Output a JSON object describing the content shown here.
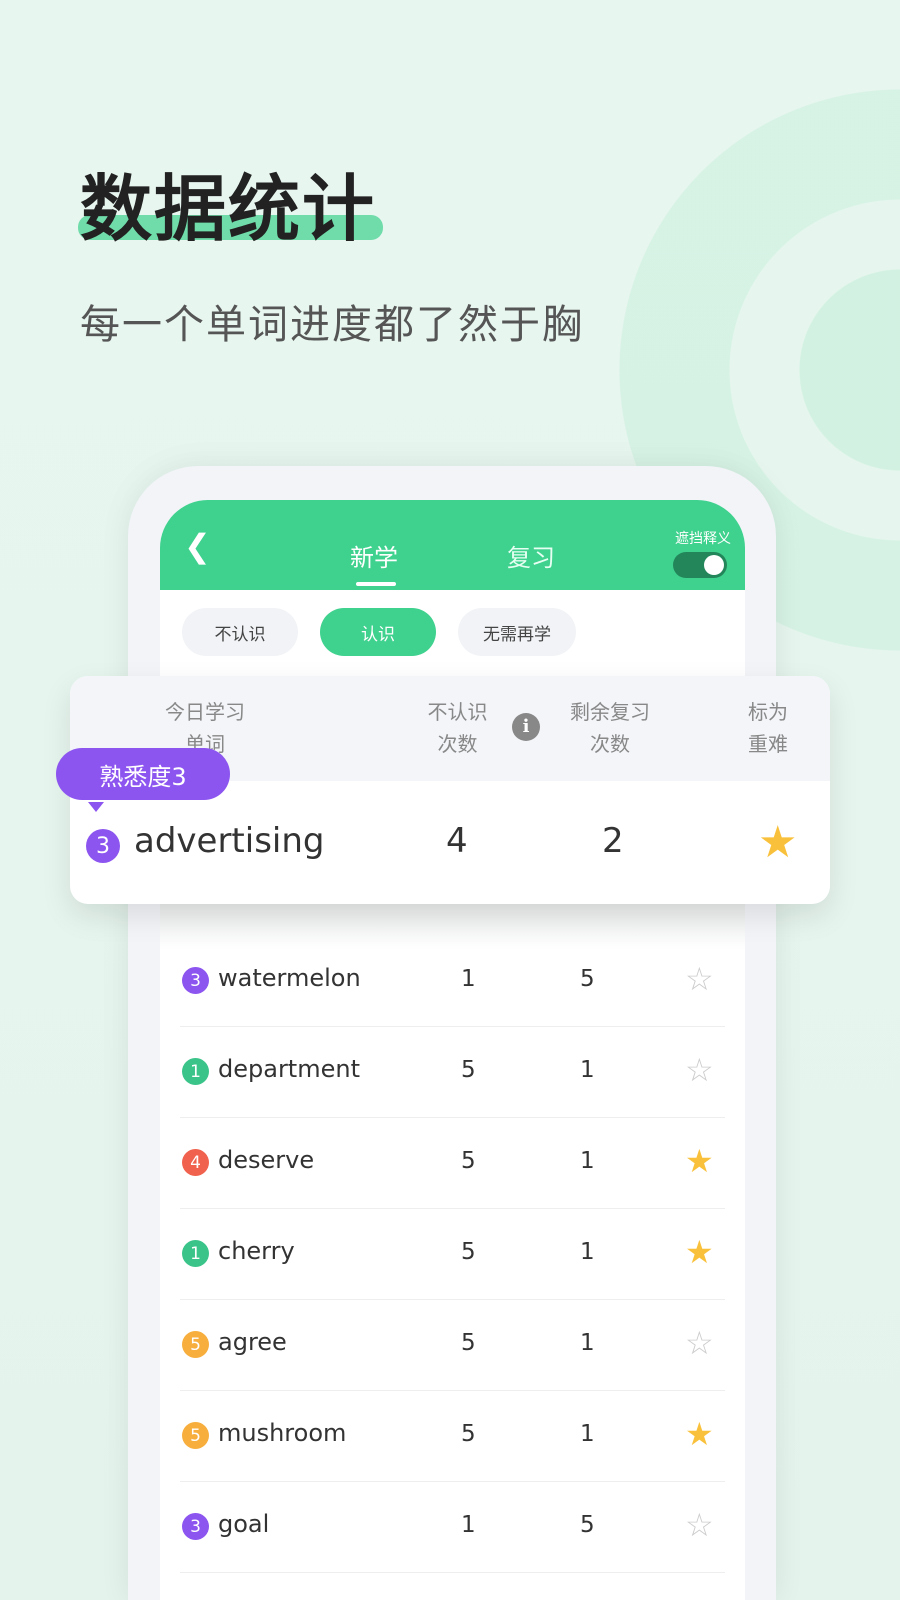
{
  "headline": {
    "title": "数据统计",
    "subtitle": "每一个单词进度都了然于胸"
  },
  "colors": {
    "brand": "#3fd18e",
    "purple": "#8c55f0",
    "green": "#3ac48a",
    "red": "#f0624d",
    "orange": "#f7ae3d",
    "star": "#f9c13b"
  },
  "app": {
    "back_icon": "chevron-left",
    "tabs": [
      {
        "label": "新学",
        "active": true
      },
      {
        "label": "复习",
        "active": false
      }
    ],
    "toggle": {
      "label": "遮挡释义",
      "on": true
    },
    "filters": [
      {
        "label": "不认识",
        "active": false
      },
      {
        "label": "认识",
        "active": true
      },
      {
        "label": "无需再学",
        "active": false
      }
    ],
    "columns": {
      "word_l1": "今日学习",
      "word_l2": "单词",
      "unknown_l1": "不认识",
      "unknown_l2": "次数",
      "remain_l1": "剩余复习",
      "remain_l2": "次数",
      "mark_l1": "标为",
      "mark_l2": "重难"
    },
    "tooltip": "熟悉度3",
    "featured": {
      "level": "3",
      "word": "advertising",
      "unknown": "4",
      "remaining": "2",
      "starred": true
    },
    "rows": [
      {
        "level": "3",
        "color": "purple",
        "word": "watermelon",
        "unknown": "1",
        "remaining": "5",
        "starred": false
      },
      {
        "level": "1",
        "color": "green",
        "word": "department",
        "unknown": "5",
        "remaining": "1",
        "starred": false
      },
      {
        "level": "4",
        "color": "red",
        "word": "deserve",
        "unknown": "5",
        "remaining": "1",
        "starred": true
      },
      {
        "level": "1",
        "color": "green",
        "word": "cherry",
        "unknown": "5",
        "remaining": "1",
        "starred": true
      },
      {
        "level": "5",
        "color": "orange",
        "word": "agree",
        "unknown": "5",
        "remaining": "1",
        "starred": false
      },
      {
        "level": "5",
        "color": "orange",
        "word": "mushroom",
        "unknown": "5",
        "remaining": "1",
        "starred": true
      },
      {
        "level": "3",
        "color": "purple",
        "word": "goal",
        "unknown": "1",
        "remaining": "5",
        "starred": false
      }
    ]
  }
}
